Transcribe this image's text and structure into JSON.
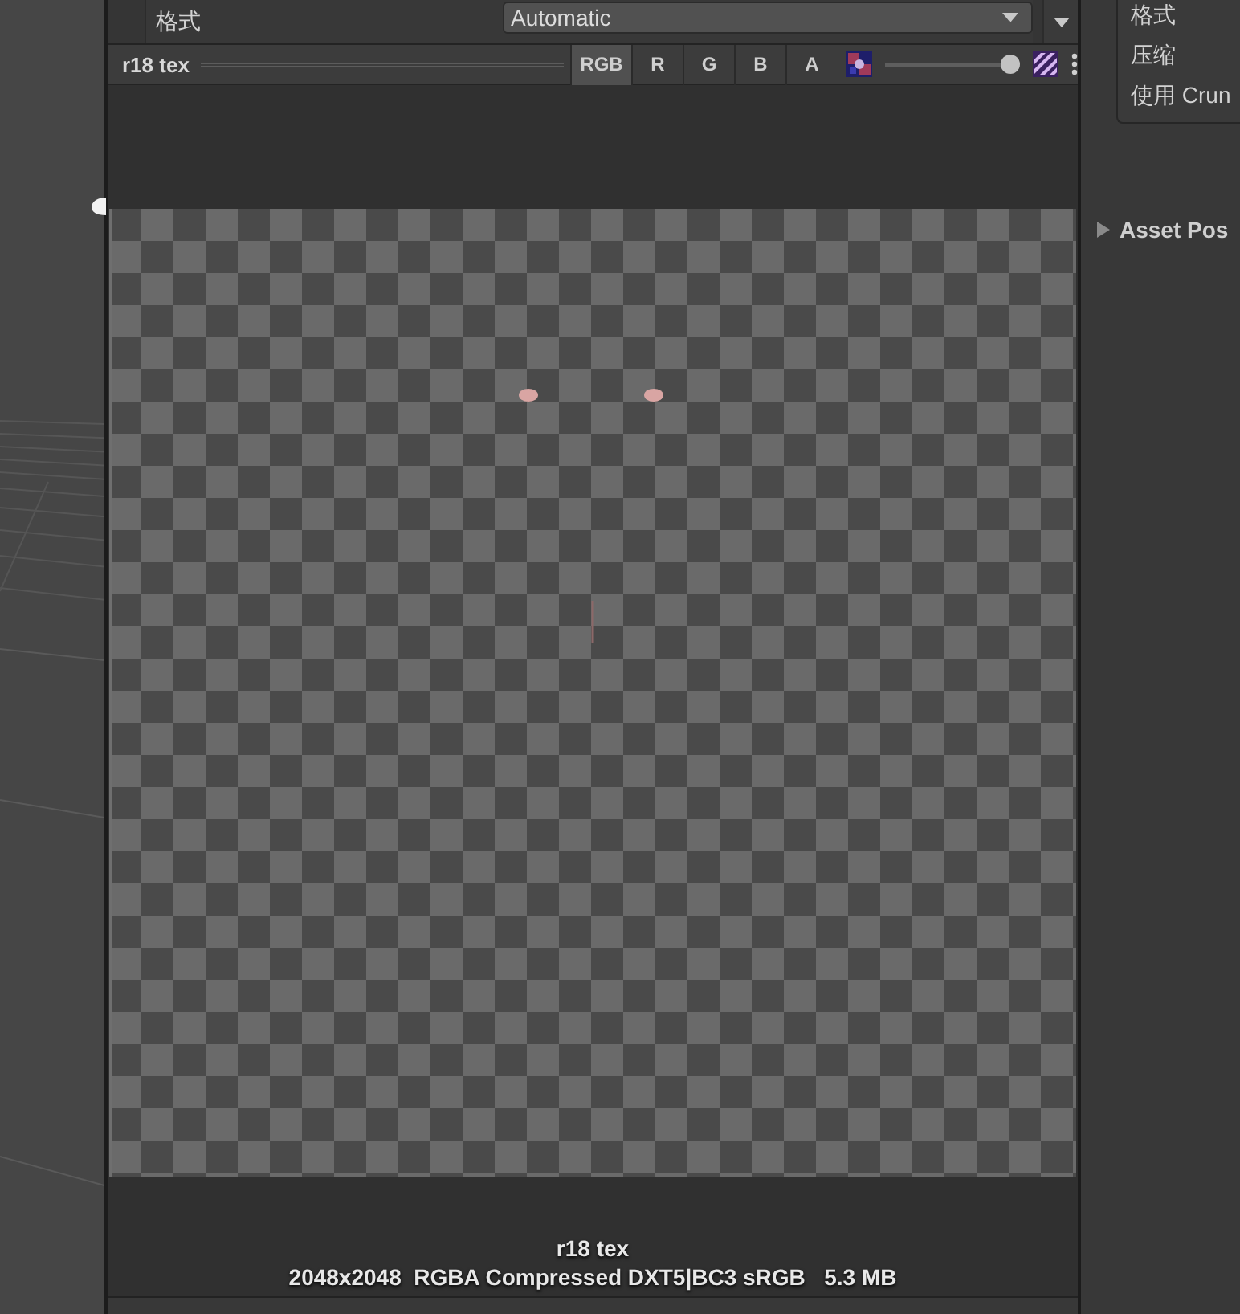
{
  "inspector": {
    "rows": [
      {
        "label": "格式",
        "value": "Automatic"
      }
    ]
  },
  "preview": {
    "title": "r18 tex",
    "channels": [
      {
        "label": "RGB",
        "selected": true
      },
      {
        "label": "R",
        "selected": false
      },
      {
        "label": "G",
        "selected": false
      },
      {
        "label": "B",
        "selected": false
      },
      {
        "label": "A",
        "selected": false
      }
    ],
    "mip_slider": {
      "level": 1
    },
    "caption": "r18 tex",
    "info": "2048x2048  RGBA Compressed DXT5|BC3 sRGB   5.3 MB"
  },
  "side_panel": {
    "settings": [
      "格式",
      "压缩",
      "使用 Crun"
    ],
    "section": {
      "label": "Asset Pos",
      "expanded": false
    }
  }
}
